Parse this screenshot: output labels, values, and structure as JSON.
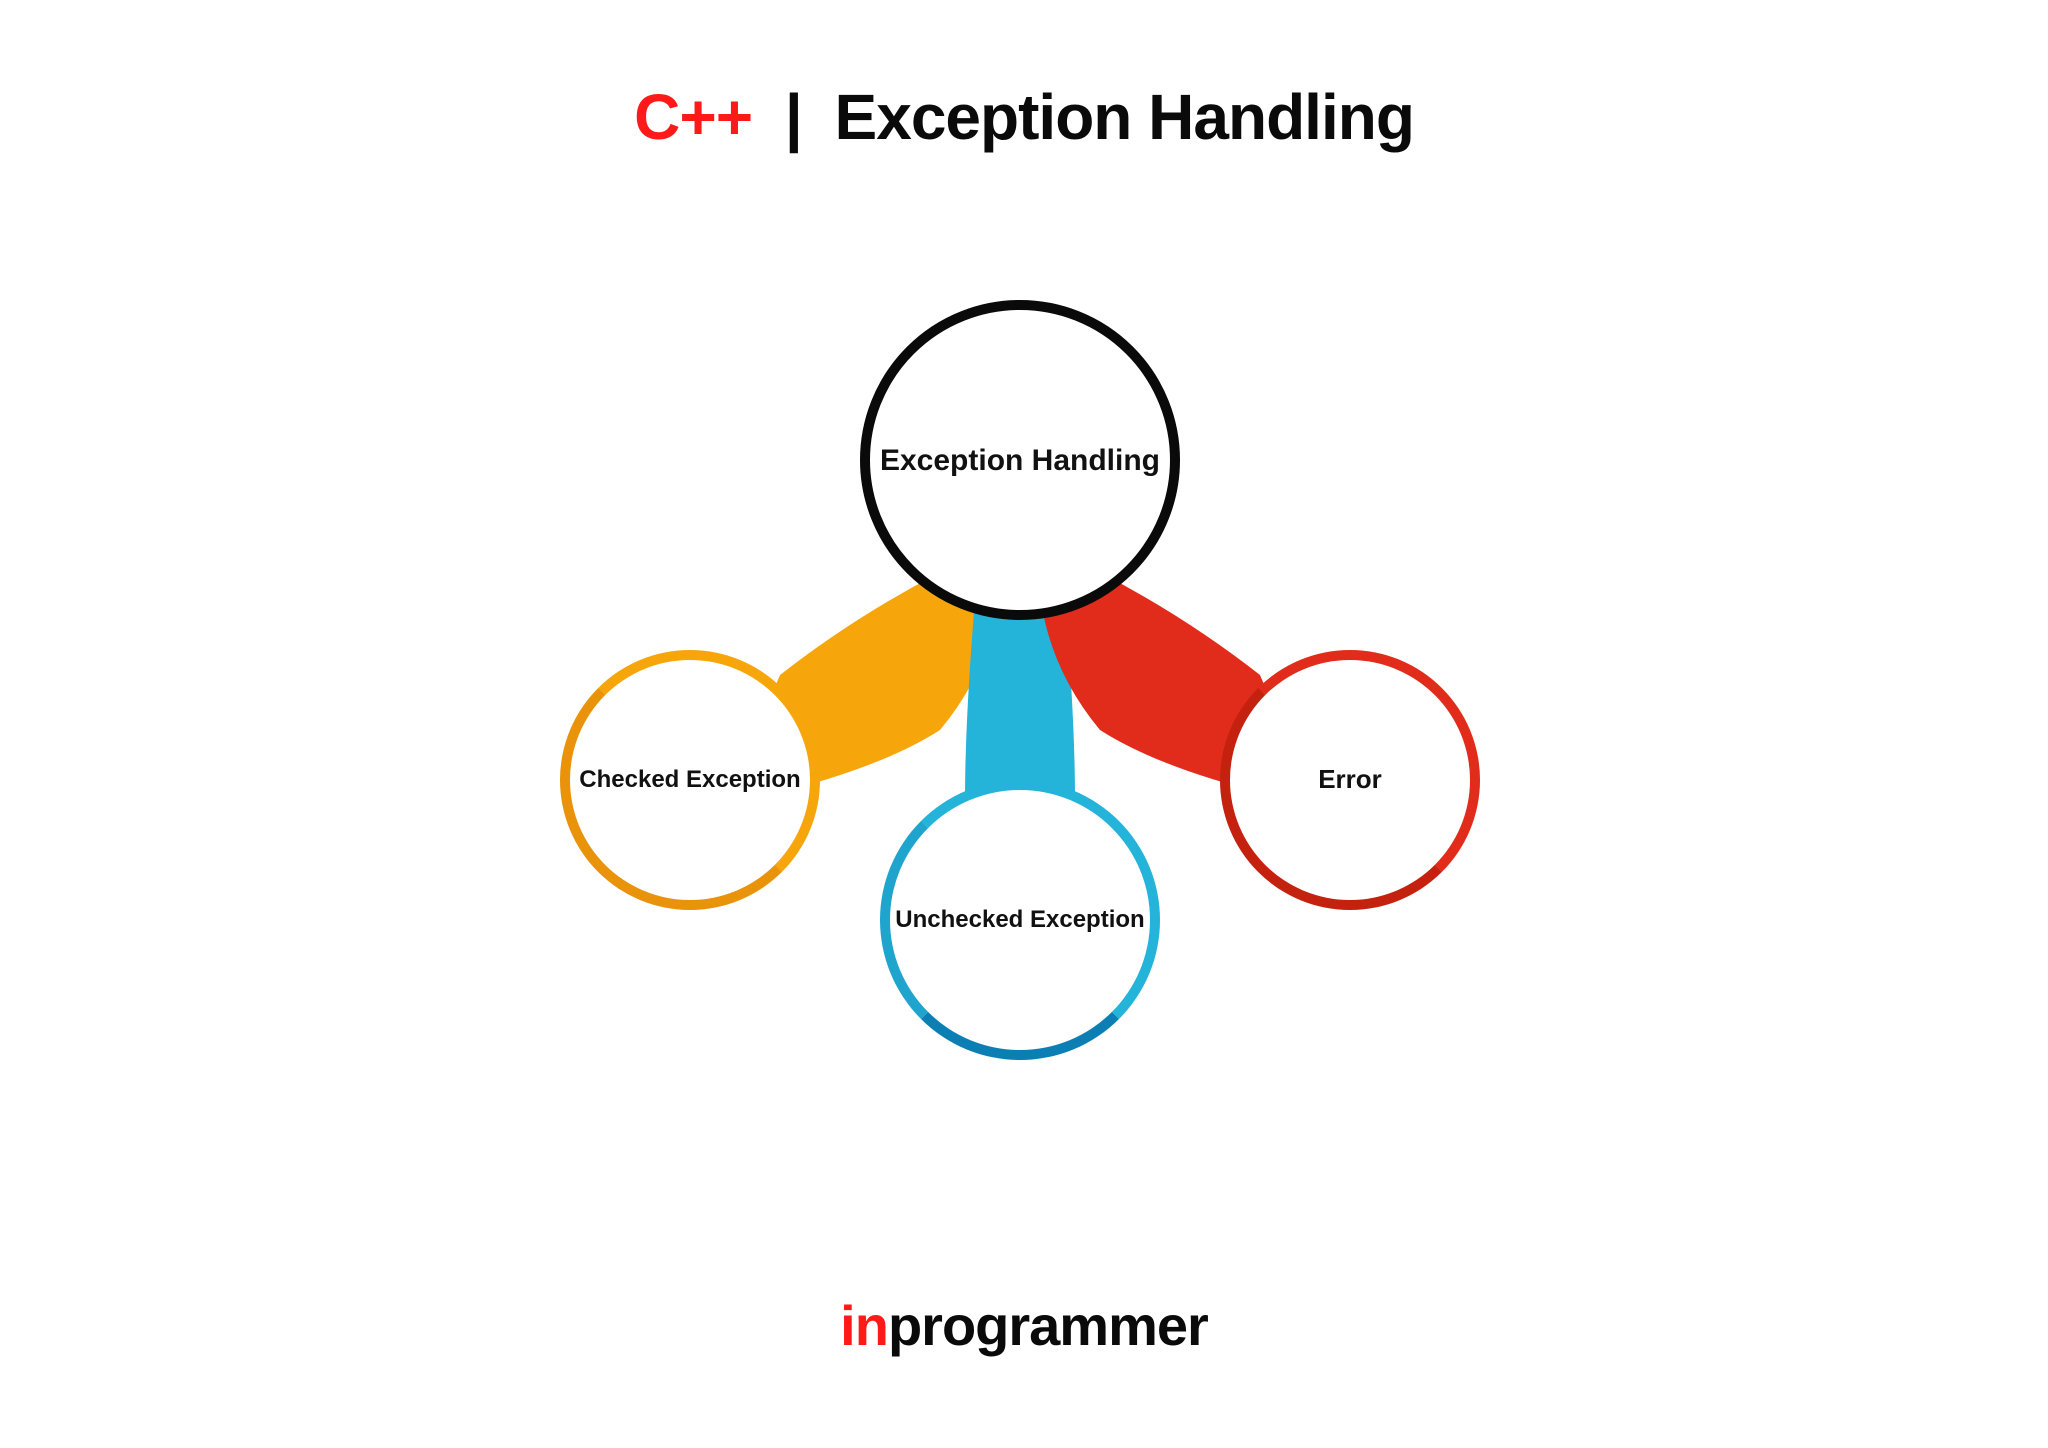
{
  "title": {
    "lang": "C++",
    "separator": "|",
    "rest": "Exception Handling"
  },
  "diagram": {
    "root": {
      "label": "Exception Handling",
      "color": "#0a0a0a"
    },
    "children": [
      {
        "label": "Checked Exception",
        "color": "#f6a60b"
      },
      {
        "label": "Unchecked Exception",
        "color": "#24b3d9"
      },
      {
        "label": "Error",
        "color": "#e12c1b"
      }
    ]
  },
  "footer": {
    "brand_prefix": "in",
    "brand_rest": "programmer"
  },
  "colors": {
    "accent_red": "#ff1a1a",
    "yellow": "#f6a60b",
    "cyan": "#24b3d9",
    "red": "#e12c1b",
    "black": "#0a0a0a"
  }
}
